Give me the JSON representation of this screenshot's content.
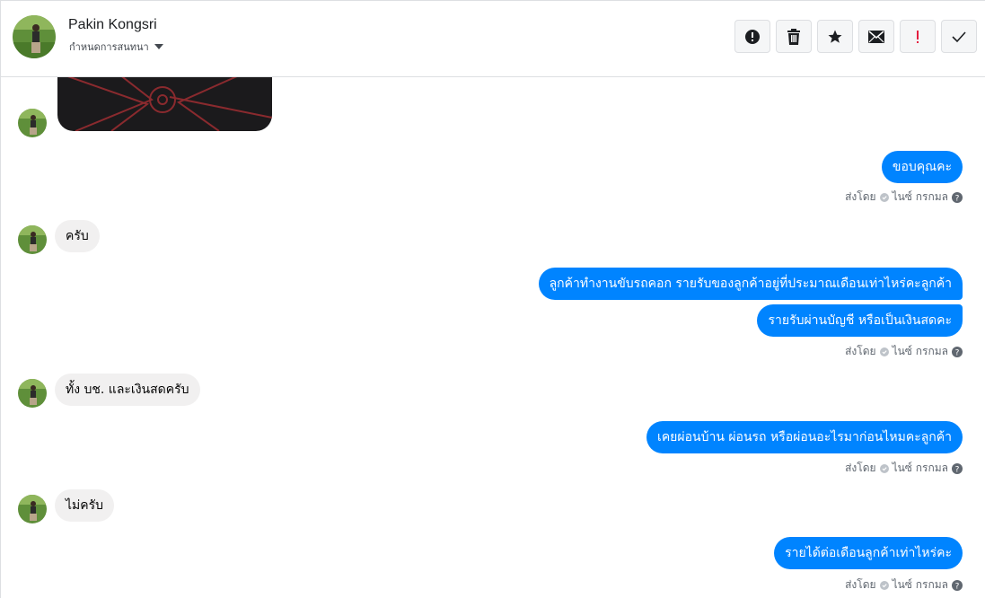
{
  "header": {
    "contact_name": "Pakin Kongsri",
    "subtitle": "กำหนดการสนทนา",
    "toolbar_icons": [
      "exclamation-circle-icon",
      "trash-icon",
      "star-icon",
      "envelope-icon",
      "exclamation-mark-icon",
      "checkmark-icon"
    ],
    "toolbar_important_color": "#e41e3f"
  },
  "conversation": {
    "messages": [
      {
        "direction": "out",
        "text": "ขอบคุณคะ"
      },
      {
        "direction": "in",
        "text": "ครับ"
      },
      {
        "direction": "out",
        "text": "ลูกค้าทำงานขับรถคอก รายรับของลูกค้าอยู่ที่ประมาณเดือนเท่าไหร่คะลูกค้า"
      },
      {
        "direction": "out",
        "text": "รายรับผ่านบัญชี หรือเป็นเงินสดคะ"
      },
      {
        "direction": "in",
        "text": "ทั้ง บช. และเงินสดครับ"
      },
      {
        "direction": "out",
        "text": "เคยผ่อนบ้าน ผ่อนรถ หรือผ่อนอะไรมาก่อนไหมคะลูกค้า"
      },
      {
        "direction": "in",
        "text": "ไม่ครับ"
      },
      {
        "direction": "out",
        "text": "รายได้ต่อเดือนลูกค้าเท่าไหร่คะ"
      }
    ],
    "status_label": "ส่งโดย",
    "status_date": "ไนซ์ กรกมล",
    "outgoing_color": "#0084ff",
    "incoming_color": "#f1f0f0"
  }
}
